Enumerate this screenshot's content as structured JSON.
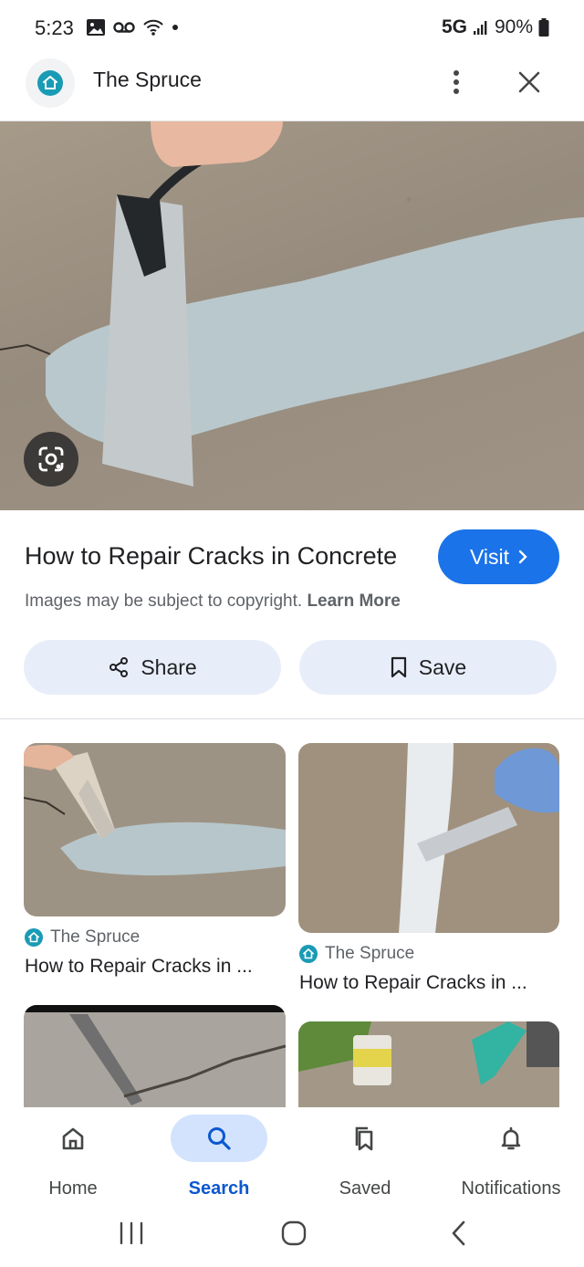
{
  "status_bar": {
    "time": "5:23",
    "network": "5G",
    "battery": "90%"
  },
  "header": {
    "site_name": "The Spruce"
  },
  "result": {
    "title": "How to Repair Cracks in Concrete",
    "visit_label": "Visit",
    "copyright_text": "Images may be subject to copyright.",
    "learn_more_label": "Learn More",
    "share_label": "Share",
    "save_label": "Save"
  },
  "related": [
    {
      "source": "The Spruce",
      "title": "How to Repair Cracks in ..."
    },
    {
      "source": "The Spruce",
      "title": "How to Repair Cracks in ..."
    }
  ],
  "bottom_nav": {
    "items": [
      {
        "label": "Home",
        "icon": "home-icon"
      },
      {
        "label": "Search",
        "icon": "search-icon",
        "active": true
      },
      {
        "label": "Saved",
        "icon": "saved-icon"
      },
      {
        "label": "Notifications",
        "icon": "bell-icon"
      }
    ]
  },
  "colors": {
    "accent": "#1a73e8",
    "brand": "#1a9bb5",
    "active_nav_bg": "#d3e3fd"
  }
}
